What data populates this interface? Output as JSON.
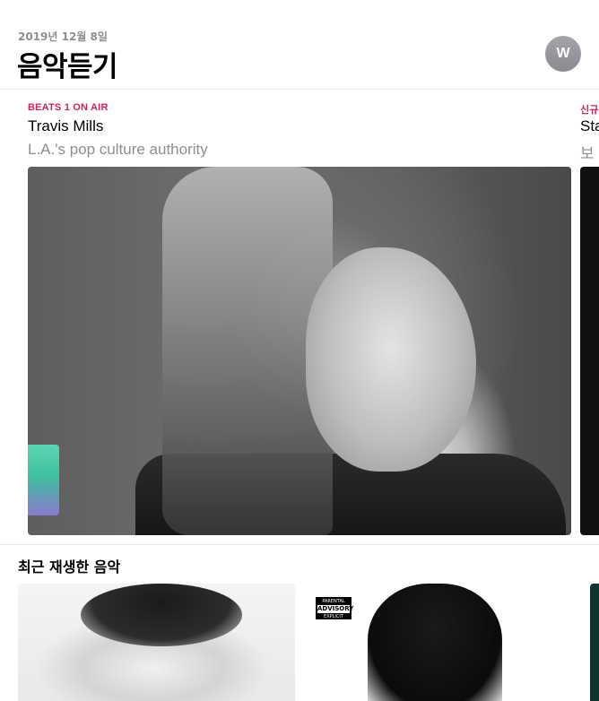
{
  "header": {
    "date": "2019년 12월 8일",
    "title": "음악듣기",
    "avatar_initial": "W"
  },
  "featured": [
    {
      "eyebrow": "BEATS 1 ON AIR",
      "title": "Travis Mills",
      "subtitle": "L.A.'s pop culture authority"
    },
    {
      "eyebrow": "신규",
      "title": "Sta",
      "subtitle": "보"
    }
  ],
  "recently_played": {
    "title": "최근 재생한 음악",
    "albums": [
      {},
      {
        "advisory": {
          "top": "PARENTAL",
          "mid": "ADVISORY",
          "bottom": "EXPLICIT CONTENT"
        }
      },
      {}
    ]
  },
  "colors": {
    "accent": "#c8255c",
    "secondary_text": "#8e8e93",
    "avatar": "#9a9aa0"
  }
}
